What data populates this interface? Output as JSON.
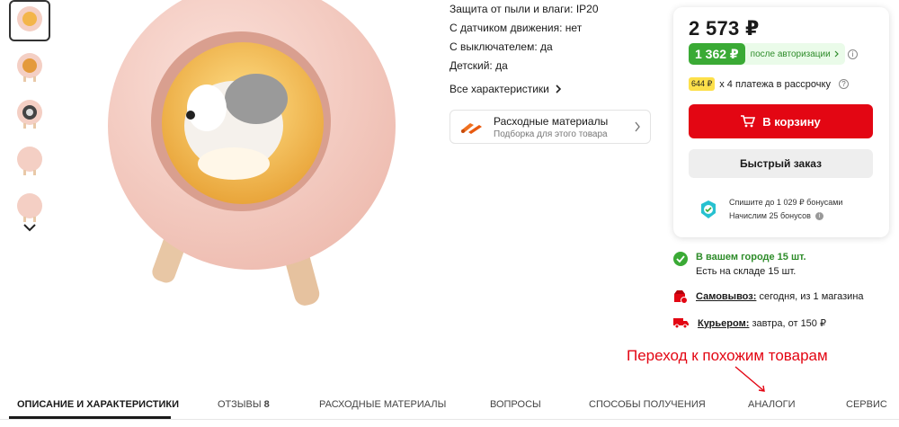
{
  "specs": [
    {
      "label": "Защита от пыли и влаги:",
      "value": "IP20"
    },
    {
      "label": "С датчиком движения:",
      "value": "нет"
    },
    {
      "label": "С выключателем:",
      "value": "да"
    },
    {
      "label": "Детский:",
      "value": "да"
    }
  ],
  "all_chars_label": "Все характеристики",
  "consumables": {
    "title": "Расходные материалы",
    "subtitle": "Подборка для этого товара"
  },
  "price": {
    "main": "2 573 ₽",
    "auth_value": "1 362 ₽",
    "auth_text": "после авторизации",
    "installment_badge": "644 ₽",
    "installment_text": "х 4 платежа в рассрочку",
    "cart_label": "В корзину",
    "quick_label": "Быстрый заказ",
    "bonus_line1": "Спишите до 1 029 ₽ бонусами",
    "bonus_line2": "Начислим 25 бонусов"
  },
  "availability": {
    "title": "В вашем городе 15 шт.",
    "subtitle": "Есть на складе 15 шт.",
    "pickup_label": "Самовывоз:",
    "pickup_text": " сегодня, из 1 магазина",
    "courier_label": "Курьером:",
    "courier_text": " завтра, от 150 ₽"
  },
  "annotation": "Переход к похожим товарам",
  "tabs": [
    {
      "label": "ОПИСАНИЕ И ХАРАКТЕРИСТИКИ"
    },
    {
      "label": "ОТЗЫВЫ",
      "count": "8"
    },
    {
      "label": "РАСХОДНЫЕ МАТЕРИАЛЫ"
    },
    {
      "label": "ВОПРОСЫ"
    },
    {
      "label": "СПОСОБЫ ПОЛУЧЕНИЯ"
    },
    {
      "label": "АНАЛОГИ"
    },
    {
      "label": "СЕРВИС"
    }
  ],
  "colors": {
    "accent": "#e30613",
    "green": "#3aaa35",
    "lamp": "#f4c9bf"
  }
}
